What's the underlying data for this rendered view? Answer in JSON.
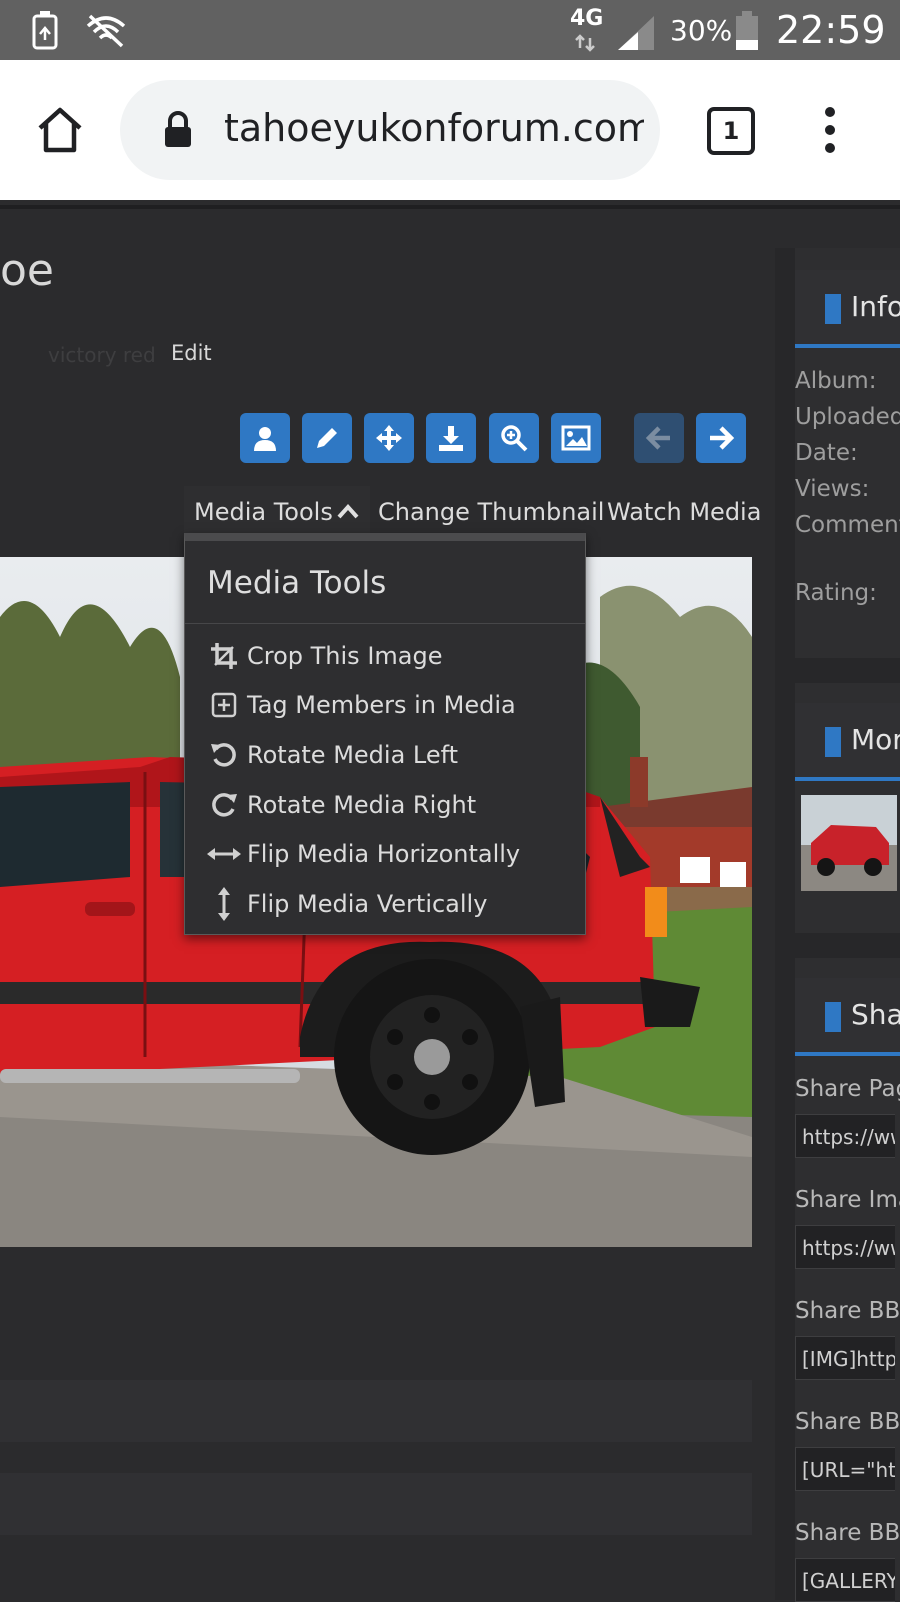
{
  "status_bar": {
    "network": "4G",
    "battery": "30%",
    "time": "22:59"
  },
  "browser": {
    "url": "tahoeyukonforum.com/",
    "tab_count": "1"
  },
  "page": {
    "title_fragment": "oe",
    "tag": "victory red",
    "edit_label": "Edit"
  },
  "tabs": {
    "media_tools": "Media Tools",
    "change_thumbnail": "Change Thumbnail",
    "watch_media": "Watch Media"
  },
  "dropdown": {
    "title": "Media Tools",
    "items": [
      {
        "label": "Crop This Image",
        "icon": "crop-icon"
      },
      {
        "label": "Tag Members in Media",
        "icon": "plus-square-icon"
      },
      {
        "label": "Rotate Media Left",
        "icon": "rotate-left-icon"
      },
      {
        "label": "Rotate Media Right",
        "icon": "rotate-right-icon"
      },
      {
        "label": "Flip Media Horizontally",
        "icon": "arrows-horizontal-icon"
      },
      {
        "label": "Flip Media Vertically",
        "icon": "arrows-vertical-icon"
      }
    ]
  },
  "sidebar": {
    "info": {
      "title": "Info",
      "labels": [
        "Album:",
        "Uploaded",
        "Date:",
        "Views:",
        "Comment",
        "Rating:"
      ]
    },
    "more": {
      "title": "Mor"
    },
    "share": {
      "title": "Sha",
      "fields": [
        {
          "label": "Share Pag",
          "value": "https://ww"
        },
        {
          "label": "Share Ima",
          "value": "https://ww"
        },
        {
          "label": "Share BB",
          "value": "[IMG]https"
        },
        {
          "label": "Share BB",
          "value": "[URL=\"http"
        },
        {
          "label": "Share BB",
          "value": "[GALLERY"
        }
      ]
    }
  },
  "colors": {
    "accent": "#2f78c4",
    "page_bg": "#2b2b2d",
    "dropdown_bg": "#2e2e30"
  }
}
